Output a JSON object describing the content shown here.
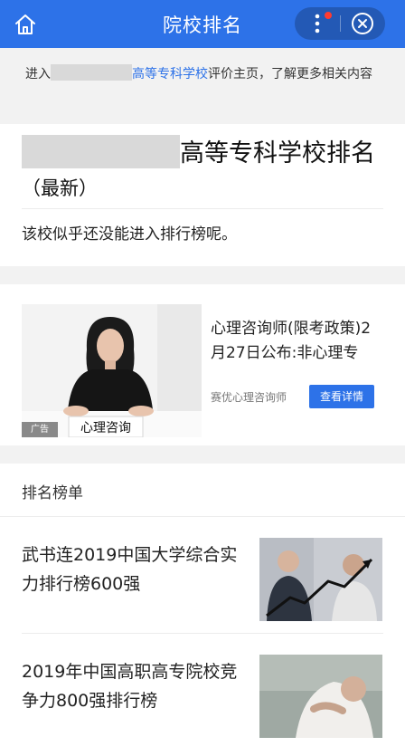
{
  "header": {
    "title": "院校排名",
    "icons": {
      "home": "home-icon",
      "more": "more-icon",
      "close": "close-icon"
    },
    "colors": {
      "bar": "#2d72e8",
      "badge": "#ff3b30"
    }
  },
  "intro": {
    "prefix": "进入",
    "link_text": "高等专科学校",
    "suffix": "评价主页，了解更多相关内容"
  },
  "ranking": {
    "title_suffix": "高等专科学校排名",
    "title_note": "（最新）",
    "message": "该校似乎还没能进入排行榜呢。"
  },
  "ad": {
    "image_caption": "心理咨询",
    "tag": "广告",
    "title": "心理咨询师(限考政策)2月27日公布:非心理专业...",
    "source": "赛优心理咨询师",
    "cta": "查看详情"
  },
  "list": {
    "header": "排名榜单",
    "items": [
      {
        "title": "武书连2019中国大学综合实力排行榜600强"
      },
      {
        "title": "2019年中国高职高专院校竞争力800强排行榜"
      }
    ]
  }
}
